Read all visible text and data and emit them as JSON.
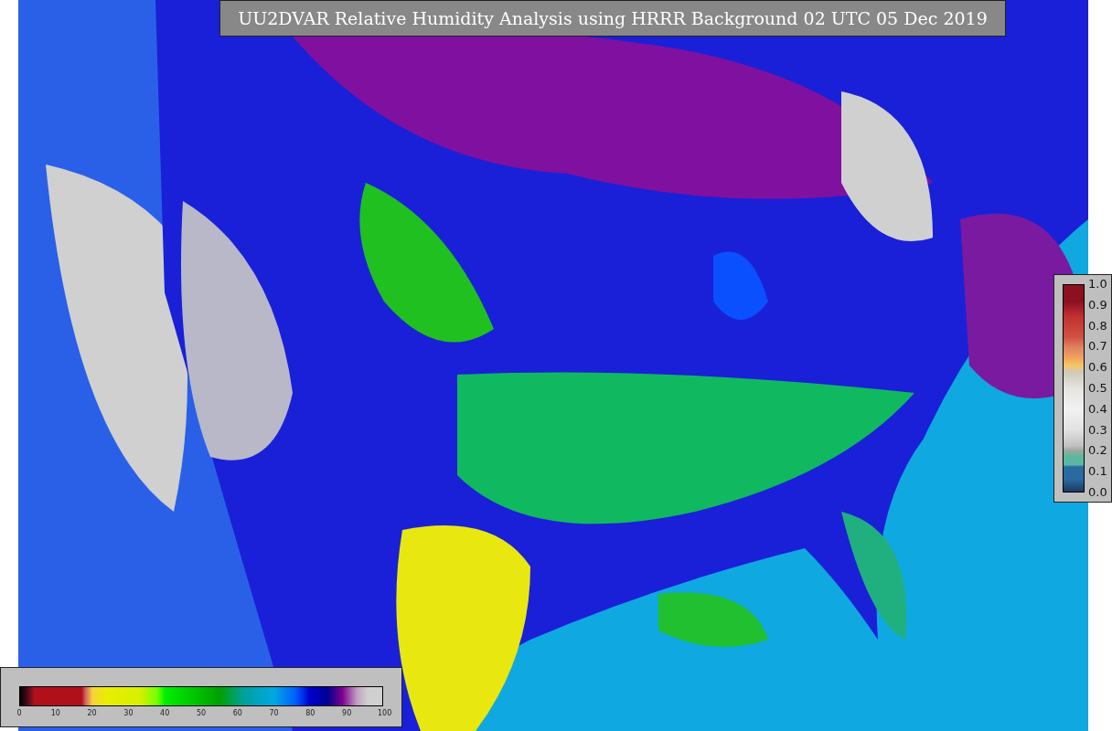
{
  "title": "UU2DVAR Relative Humidity Analysis using HRRR Background 02 UTC 05 Dec 2019",
  "humidity_colorbar": {
    "ticks": [
      "0",
      "10",
      "20",
      "30",
      "40",
      "50",
      "60",
      "70",
      "80",
      "90",
      "100"
    ]
  },
  "ratio_colorbar": {
    "ticks": [
      "1.0",
      "0.9",
      "0.8",
      "0.7",
      "0.6",
      "0.5",
      "0.4",
      "0.3",
      "0.2",
      "0.1",
      "0.0"
    ]
  }
}
